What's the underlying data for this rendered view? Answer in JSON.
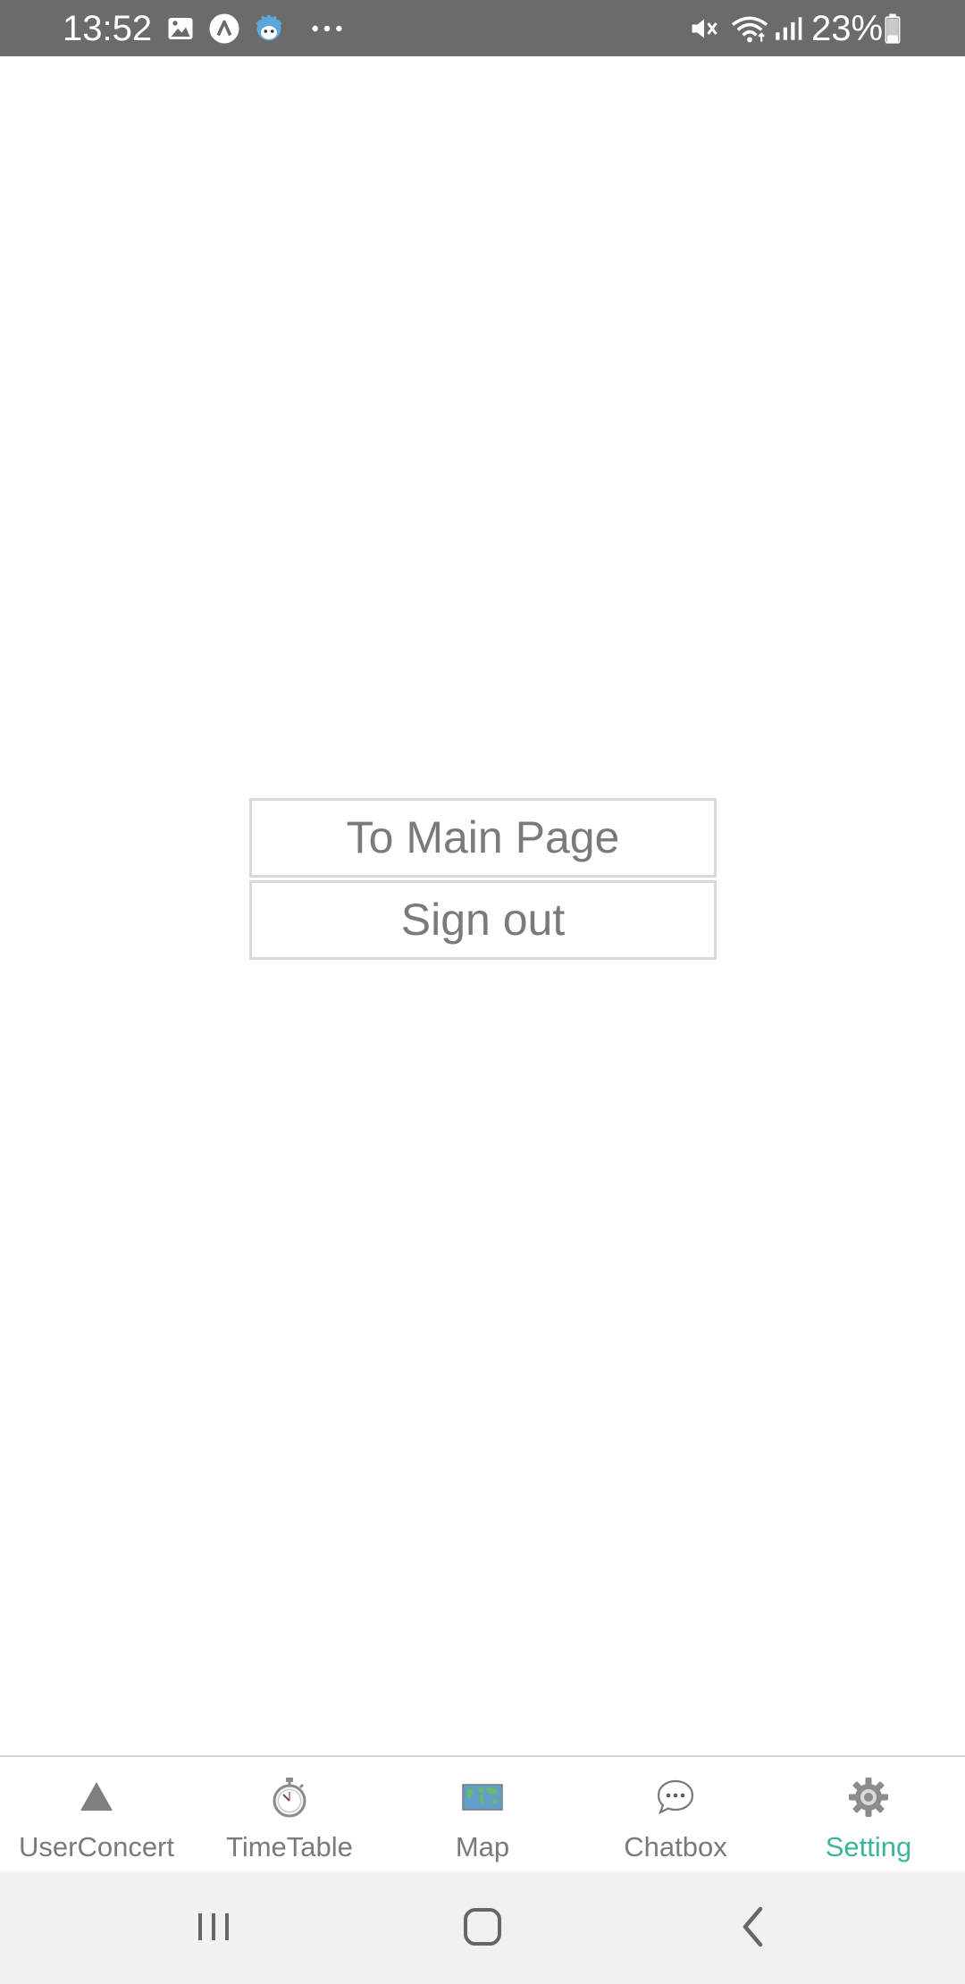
{
  "status_bar": {
    "time": "13:52",
    "battery_percent": "23%",
    "left_icons": [
      "gallery-icon",
      "app-a-icon",
      "avatar-icon",
      "more-dots-icon"
    ],
    "right_icons": [
      "vibrate-mute-icon",
      "wifi-icon",
      "signal-icon",
      "battery-icon"
    ]
  },
  "main": {
    "buttons": [
      {
        "label": "To Main Page"
      },
      {
        "label": "Sign out"
      }
    ]
  },
  "tab_bar": {
    "active_index": 4,
    "active_color": "#3cb59c",
    "inactive_color": "#7a7a7a",
    "tabs": [
      {
        "label": "UserConcert",
        "icon": "triangle-icon"
      },
      {
        "label": "TimeTable",
        "icon": "stopwatch-icon"
      },
      {
        "label": "Map",
        "icon": "world-map-icon"
      },
      {
        "label": "Chatbox",
        "icon": "chat-bubble-icon"
      },
      {
        "label": "Setting",
        "icon": "gear-icon"
      }
    ]
  },
  "nav_bar": {
    "buttons": [
      "recents-icon",
      "home-icon",
      "back-icon"
    ]
  }
}
